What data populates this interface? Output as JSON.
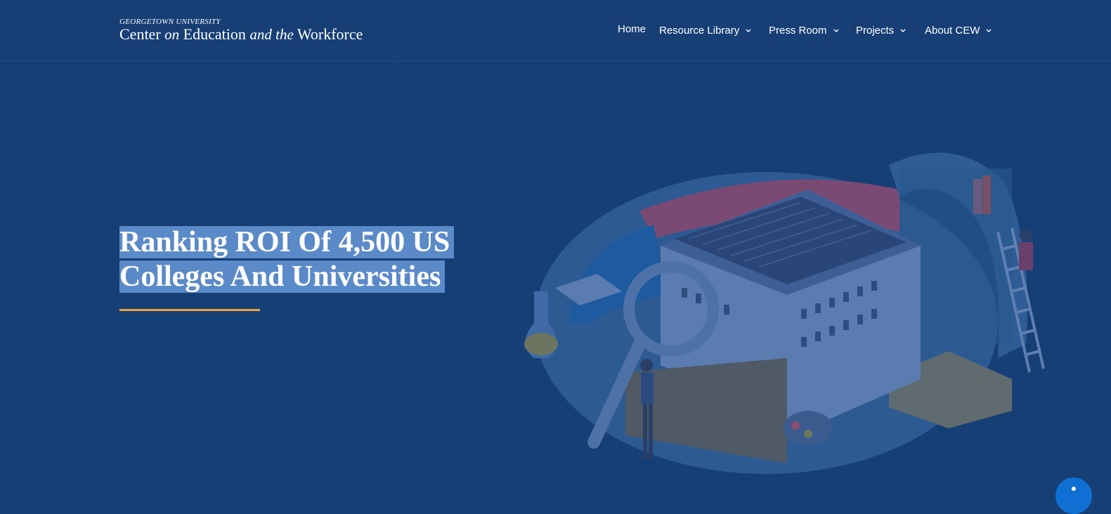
{
  "logo": {
    "university": "GEORGETOWN UNIVERSITY",
    "name_part1": "Center",
    "name_part2": "on",
    "name_part3": "Education",
    "name_part4": "and the",
    "name_part5": "Workforce"
  },
  "nav": {
    "items": [
      {
        "label": "Home"
      },
      {
        "label": "Resource Library",
        "has_dropdown": true
      },
      {
        "label": "Press Room",
        "has_dropdown": true
      },
      {
        "label": "Projects",
        "has_dropdown": true
      },
      {
        "label": "About CEW",
        "has_dropdown": true
      }
    ],
    "chevron_icon": "chevron-down-icon"
  },
  "hero": {
    "title_line1": "Ranking ROI Of 4,500 US",
    "title_line2": "Colleges And Universities",
    "illustration": "university-building-illustration"
  },
  "chat": {
    "icon": "chat-icon"
  },
  "colors": {
    "background": "#163f76",
    "selection_highlight": "#5b8ac8",
    "underline_accent": "#e8a43a",
    "chat_button": "#0f6fd3"
  }
}
